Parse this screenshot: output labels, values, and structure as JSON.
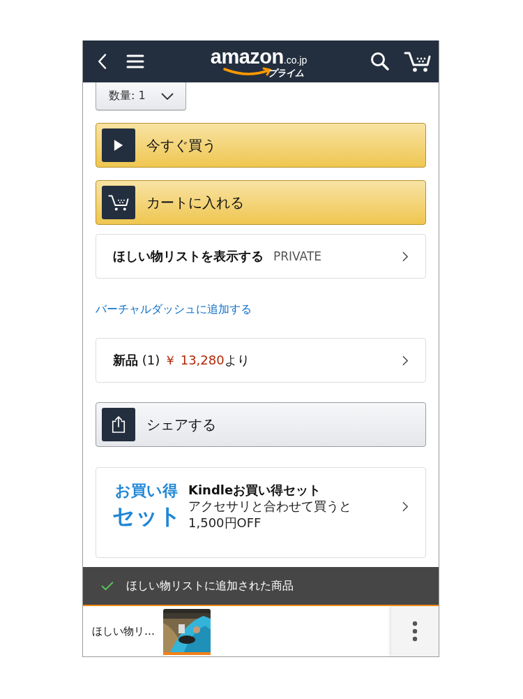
{
  "header": {
    "logo": "amazon",
    "domain": ".co.jp",
    "sub": "プライム"
  },
  "quantity": {
    "label": "数量:",
    "value": "1"
  },
  "buttons": [
    {
      "kind": "buy",
      "label": "今すぐ買う"
    },
    {
      "kind": "cart",
      "label": "カートに入れる"
    }
  ],
  "wishlist": {
    "label": "ほしい物リストを表示する",
    "badge": "PRIVATE"
  },
  "link": "バーチャルダッシュに追加する",
  "offers": {
    "label": "新品",
    "count": "(1)",
    "price": "￥ 13,280",
    "suffix": "より"
  },
  "share": {
    "label": "シェアする"
  },
  "promo": {
    "badge_lines": [
      "お買い得",
      "セット"
    ],
    "title": "Kindleお買い得セット",
    "lines": [
      "アクセサリと合わせて買うと",
      "1,500円OFF"
    ]
  },
  "toast": {
    "text": "ほしい物リストに追加された商品"
  },
  "wishlist_bar": {
    "label": "ほしい物リ…"
  }
}
